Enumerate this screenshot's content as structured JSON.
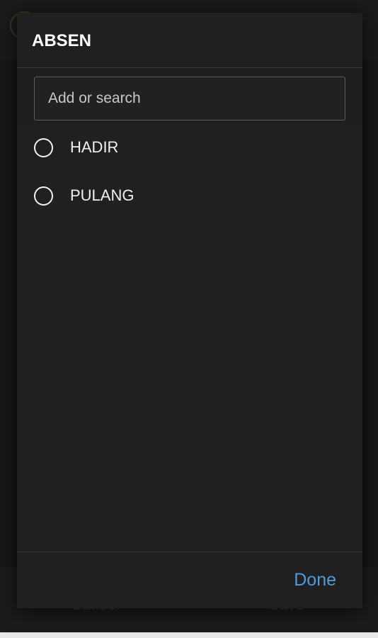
{
  "dialog": {
    "title": "ABSEN",
    "search": {
      "value": "",
      "placeholder": "Add or search"
    },
    "options": [
      {
        "label": "HADIR",
        "selected": false
      },
      {
        "label": "PULANG",
        "selected": false
      }
    ],
    "done_label": "Done"
  },
  "background": {
    "cancel_label": "Cancel",
    "save_label": "Save"
  },
  "colors": {
    "dialog_bg": "#202020",
    "accent": "#4f9bdc",
    "text": "#f0f0f0"
  }
}
